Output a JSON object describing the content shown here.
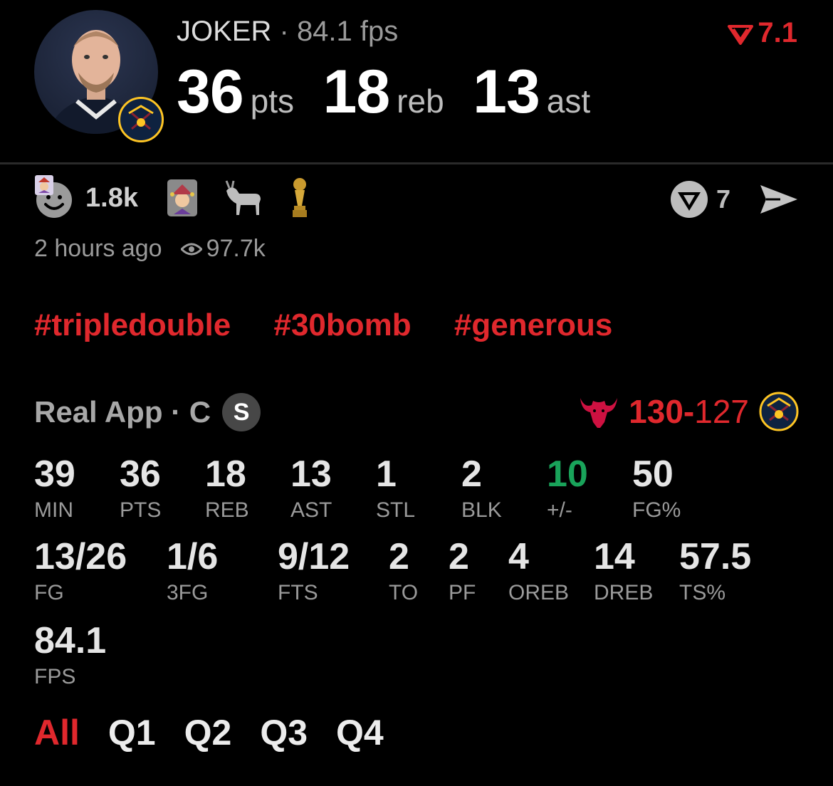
{
  "colors": {
    "accent_red": "#e0282d",
    "positive_green": "#19a35a",
    "background": "#000000"
  },
  "header": {
    "player_name": "JOKER",
    "separator": "·",
    "fps_label": "84.1 fps",
    "rating": "7.1",
    "rating_icon": "red-arrow-logo-icon",
    "avatar_icon": "player-photo",
    "team_icon": "nuggets-logo-icon",
    "headline_stats": [
      {
        "value": "36",
        "unit": "pts"
      },
      {
        "value": "18",
        "unit": "reb"
      },
      {
        "value": "13",
        "unit": "ast"
      }
    ]
  },
  "reactions": {
    "top_reaction_icon": "smiley-face-icon",
    "top_reaction_badge_icon": "jester-emoji-icon",
    "count": "1.8k",
    "emojis": [
      "jester-card-icon",
      "goat-icon",
      "trophy-icon"
    ],
    "comments_icon": "comment-logo-icon",
    "comments_count": "7",
    "share_icon": "send-icon"
  },
  "meta": {
    "time_ago": "2 hours ago",
    "views_icon": "eye-icon",
    "views": "97.7k"
  },
  "hashtags": [
    "#tripledouble",
    "#30bomb",
    "#generous"
  ],
  "source": {
    "label": "Real App · C",
    "badge": "S"
  },
  "game": {
    "home_icon": "bulls-logo-icon",
    "home_score": "130",
    "dash": "-",
    "away_score": "127",
    "away_icon": "nuggets-logo-icon"
  },
  "stats_row1": [
    {
      "value": "39",
      "label": "MIN"
    },
    {
      "value": "36",
      "label": "PTS"
    },
    {
      "value": "18",
      "label": "REB"
    },
    {
      "value": "13",
      "label": "AST"
    },
    {
      "value": "1",
      "label": "STL"
    },
    {
      "value": "2",
      "label": "BLK"
    },
    {
      "value": "10",
      "label": "+/-"
    },
    {
      "value": "50",
      "label": "FG%"
    }
  ],
  "stats_row2": [
    {
      "value": "13/26",
      "label": "FG"
    },
    {
      "value": "1/6",
      "label": "3FG"
    },
    {
      "value": "9/12",
      "label": "FTS"
    },
    {
      "value": "2",
      "label": "TO"
    },
    {
      "value": "2",
      "label": "PF"
    },
    {
      "value": "4",
      "label": "OREB"
    },
    {
      "value": "14",
      "label": "DREB"
    },
    {
      "value": "57.5",
      "label": "TS%"
    }
  ],
  "stats_row3": [
    {
      "value": "84.1",
      "label": "FPS"
    }
  ],
  "tabs": [
    "All",
    "Q1",
    "Q2",
    "Q3",
    "Q4"
  ],
  "active_tab": "All"
}
